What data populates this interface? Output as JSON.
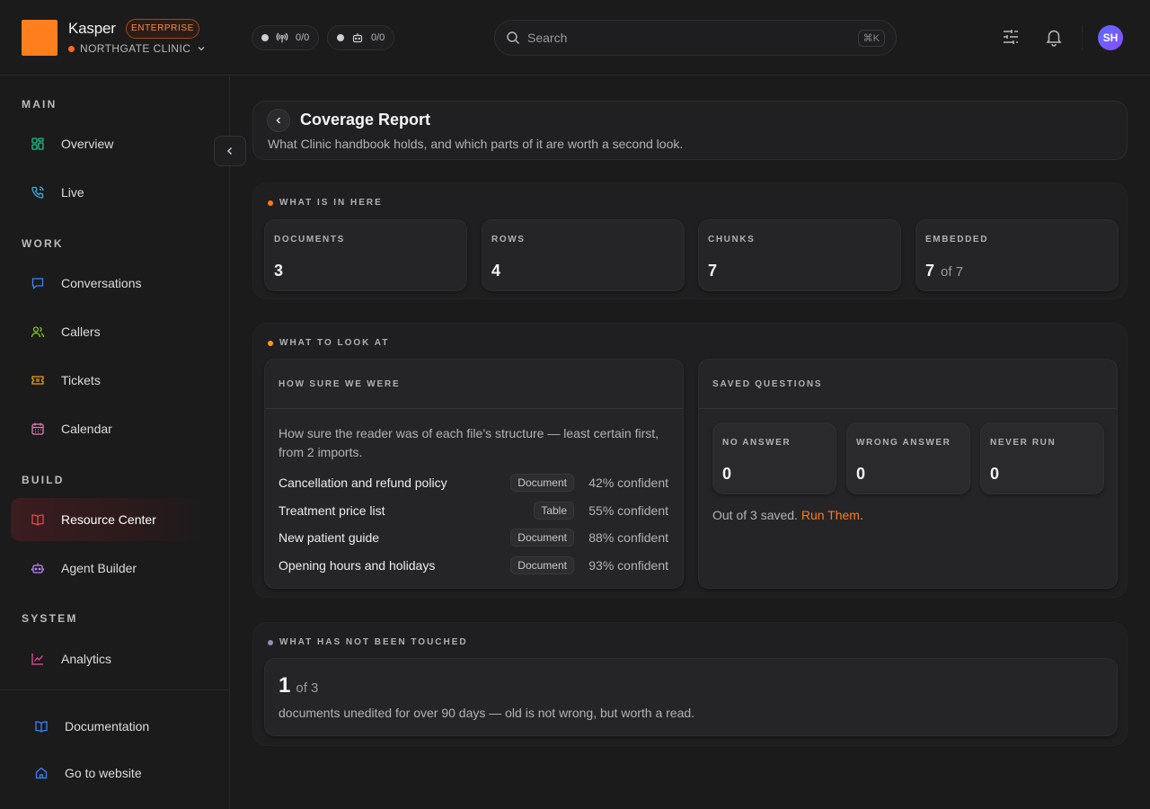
{
  "brand": {
    "name": "Kasper",
    "plan": "ENTERPRISE",
    "org": "NORTHGATE CLINIC"
  },
  "header": {
    "status_pills": [
      {
        "icon": "broadcast-icon",
        "count": "0/0"
      },
      {
        "icon": "robot-icon",
        "count": "0/0"
      }
    ],
    "search": {
      "placeholder": "Search",
      "shortcut": "⌘K"
    },
    "avatar_initials": "SH"
  },
  "sidebar": {
    "sections": [
      {
        "label": "MAIN",
        "items": [
          {
            "label": "Overview",
            "icon": "grid-icon"
          },
          {
            "label": "Live",
            "icon": "phone-icon"
          }
        ]
      },
      {
        "label": "WORK",
        "items": [
          {
            "label": "Conversations",
            "icon": "chat-icon"
          },
          {
            "label": "Callers",
            "icon": "users-icon"
          },
          {
            "label": "Tickets",
            "icon": "ticket-icon"
          },
          {
            "label": "Calendar",
            "icon": "calendar-icon"
          }
        ]
      },
      {
        "label": "BUILD",
        "items": [
          {
            "label": "Resource Center",
            "icon": "book-icon",
            "active": true
          },
          {
            "label": "Agent Builder",
            "icon": "bot-icon"
          }
        ]
      },
      {
        "label": "SYSTEM",
        "items": [
          {
            "label": "Analytics",
            "icon": "chart-icon"
          }
        ]
      }
    ],
    "footer": [
      {
        "label": "Documentation",
        "icon": "book-open-icon"
      },
      {
        "label": "Go to website",
        "icon": "home-icon"
      }
    ]
  },
  "page": {
    "title": "Coverage Report",
    "subtitle": "What Clinic handbook holds, and which parts of it are worth a second look."
  },
  "inventory": {
    "heading": "WHAT IS IN HERE",
    "accent": "#ff7a1a",
    "stats": [
      {
        "label": "DOCUMENTS",
        "value": "3"
      },
      {
        "label": "ROWS",
        "value": "4"
      },
      {
        "label": "CHUNKS",
        "value": "7"
      },
      {
        "label": "EMBEDDED",
        "value": "7",
        "suffix": "of 7"
      }
    ]
  },
  "look_at": {
    "heading": "WHAT TO LOOK AT",
    "accent": "#ff9a1a",
    "confidence": {
      "title": "HOW SURE WE WERE",
      "description": "How sure the reader was of each file’s structure — least certain first, from 2 imports.",
      "rows": [
        {
          "name": "Cancellation and refund policy",
          "type": "Document",
          "confidence": "42% confident"
        },
        {
          "name": "Treatment price list",
          "type": "Table",
          "confidence": "55% confident"
        },
        {
          "name": "New patient guide",
          "type": "Document",
          "confidence": "88% confident"
        },
        {
          "name": "Opening hours and holidays",
          "type": "Document",
          "confidence": "93% confident"
        }
      ]
    },
    "saved": {
      "title": "SAVED QUESTIONS",
      "stats": [
        {
          "label": "NO ANSWER",
          "value": "0"
        },
        {
          "label": "WRONG ANSWER",
          "value": "0"
        },
        {
          "label": "NEVER RUN",
          "value": "0"
        }
      ],
      "note": "Out of 3 saved.",
      "link": "Run Them",
      "link_suffix": ".",
      "link_color": "#ff7a1a"
    }
  },
  "untouched": {
    "heading": "WHAT HAS NOT BEEN TOUCHED",
    "accent": "#8a93b8",
    "value": "1",
    "of": "of 3",
    "description": "documents unedited for over 90 days — old is not wrong, but worth a read."
  }
}
